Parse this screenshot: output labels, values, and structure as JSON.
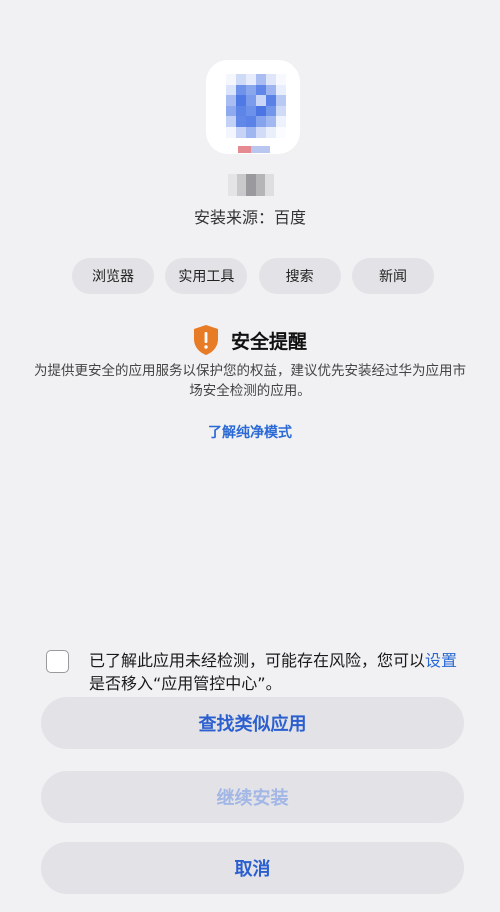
{
  "app": {
    "source_text": "安装来源：百度",
    "tags": [
      "浏览器",
      "实用工具",
      "搜索",
      "新闻"
    ]
  },
  "alert": {
    "title": "安全提醒",
    "description": "为提供更安全的应用服务以保护您的权益，建议优先安装经过华为应用市场安全检测的应用。",
    "learn_link": "了解纯净模式",
    "shield_color": "#e87b25"
  },
  "agreement": {
    "text_before": "已了解此应用未经检测，可能存在风险，您可以",
    "settings_link": "设置",
    "text_after": "是否移入“应用管控中心”。",
    "checked": false
  },
  "buttons": {
    "find_similar": "查找类似应用",
    "continue_install": "继续安装",
    "cancel": "取消"
  },
  "colors": {
    "accent": "#2b6ad4",
    "background": "#f1f1f4",
    "button_bg": "#e3e3e7"
  }
}
